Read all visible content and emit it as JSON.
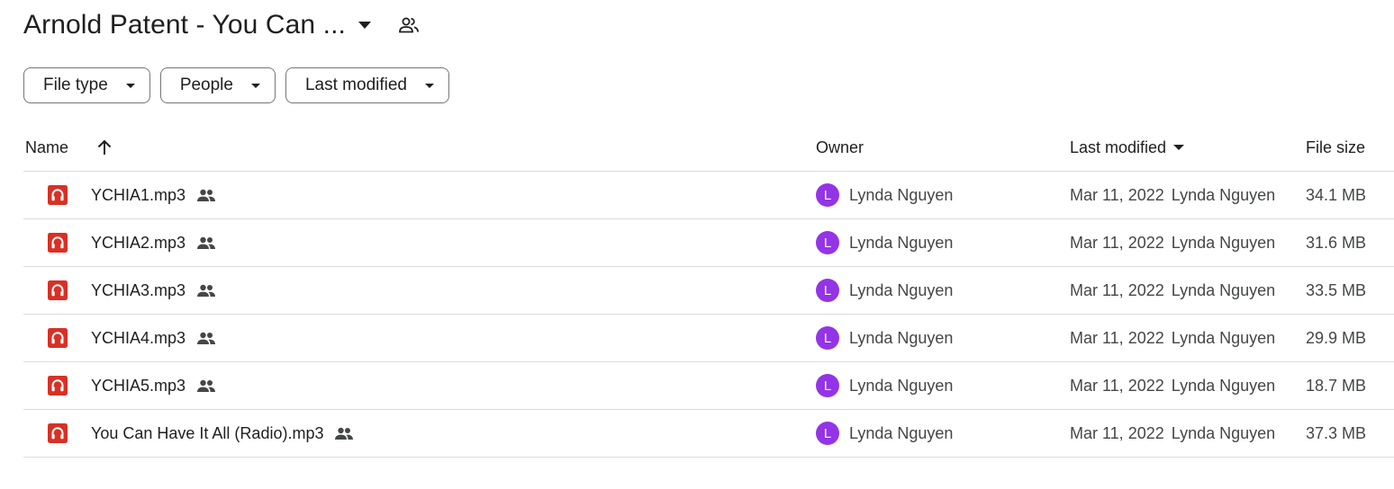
{
  "header": {
    "folder_title": "Arnold Patent - You Can ...",
    "icons": {
      "title_dropdown": "arrow-drop-down-icon",
      "shared_folder": "people-outline-icon"
    }
  },
  "filters": [
    {
      "label": "File type"
    },
    {
      "label": "People"
    },
    {
      "label": "Last modified"
    }
  ],
  "columns": {
    "name": "Name",
    "owner": "Owner",
    "last_modified": "Last modified",
    "file_size": "File size"
  },
  "files": [
    {
      "name": "YCHIA1.mp3",
      "owner_initial": "L",
      "owner": "Lynda Nguyen",
      "modified_date": "Mar 11, 2022",
      "modified_by": "Lynda Nguyen",
      "size": "34.1 MB"
    },
    {
      "name": "YCHIA2.mp3",
      "owner_initial": "L",
      "owner": "Lynda Nguyen",
      "modified_date": "Mar 11, 2022",
      "modified_by": "Lynda Nguyen",
      "size": "31.6 MB"
    },
    {
      "name": "YCHIA3.mp3",
      "owner_initial": "L",
      "owner": "Lynda Nguyen",
      "modified_date": "Mar 11, 2022",
      "modified_by": "Lynda Nguyen",
      "size": "33.5 MB"
    },
    {
      "name": "YCHIA4.mp3",
      "owner_initial": "L",
      "owner": "Lynda Nguyen",
      "modified_date": "Mar 11, 2022",
      "modified_by": "Lynda Nguyen",
      "size": "29.9 MB"
    },
    {
      "name": "YCHIA5.mp3",
      "owner_initial": "L",
      "owner": "Lynda Nguyen",
      "modified_date": "Mar 11, 2022",
      "modified_by": "Lynda Nguyen",
      "size": "18.7 MB"
    },
    {
      "name": "You Can Have It All (Radio).mp3",
      "owner_initial": "L",
      "owner": "Lynda Nguyen",
      "modified_date": "Mar 11, 2022",
      "modified_by": "Lynda Nguyen",
      "size": "37.3 MB"
    }
  ],
  "colors": {
    "audio_icon": "#d93025",
    "avatar": "#9334e6",
    "divider": "#dadce0",
    "chip_border": "#747775"
  }
}
